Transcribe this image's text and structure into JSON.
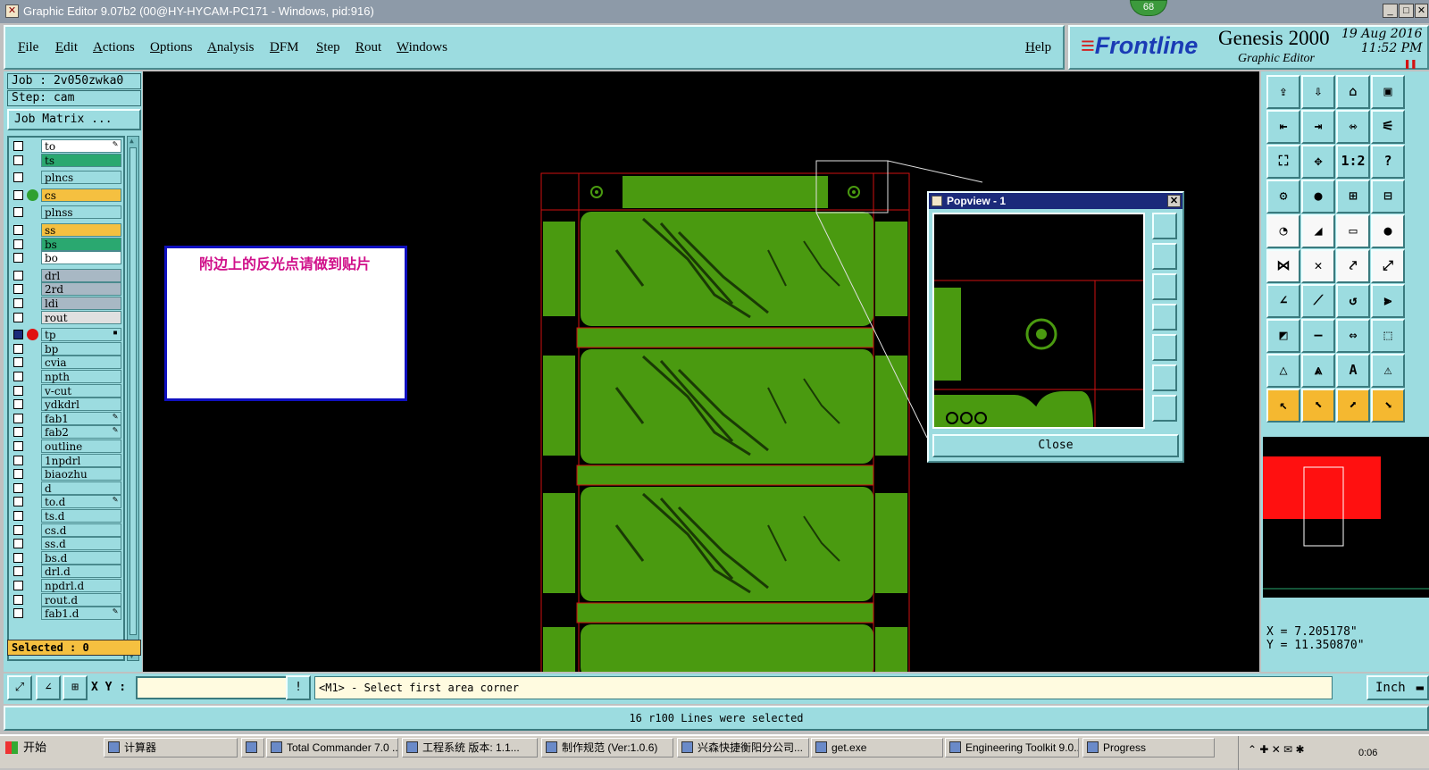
{
  "window": {
    "title": "Graphic Editor 9.07b2 (00@HY-HYCAM-PC171 - Windows, pid:916)",
    "badge": "68"
  },
  "menu": {
    "items": [
      "File",
      "Edit",
      "Actions",
      "Options",
      "Analysis",
      "DFM",
      "Step",
      "Rout",
      "Windows"
    ],
    "help": "Help"
  },
  "brand": {
    "logo": "Frontline",
    "product": "Genesis 2000",
    "subtitle": "Graphic Editor",
    "date": "19 Aug 2016",
    "time": "11:52 PM"
  },
  "job": {
    "job_label": "Job : 2v050zwka0",
    "step_label": "Step: cam",
    "matrix_button": "Job Matrix ...",
    "selected": "Selected : 0"
  },
  "layers": [
    {
      "name": "to",
      "color": "#ffffff",
      "mark": "✎"
    },
    {
      "name": "ts",
      "color": "#2aa870",
      "mark": ""
    },
    {
      "name": "plncs",
      "color": "#9cdce0",
      "mark": ""
    },
    {
      "name": "cs",
      "color": "#f5c040",
      "mark": "",
      "dot": "#30a030"
    },
    {
      "name": "plnss",
      "color": "#9cdce0",
      "mark": ""
    },
    {
      "name": "ss",
      "color": "#f5c040",
      "mark": ""
    },
    {
      "name": "bs",
      "color": "#2aa870",
      "mark": ""
    },
    {
      "name": "bo",
      "color": "#ffffff",
      "mark": ""
    },
    {
      "name": "drl",
      "color": "#a8b8c4",
      "mark": ""
    },
    {
      "name": "2rd",
      "color": "#a8b8c4",
      "mark": ""
    },
    {
      "name": "ldi",
      "color": "#a8b8c4",
      "mark": ""
    },
    {
      "name": "rout",
      "color": "#e0e0e0",
      "mark": ""
    },
    {
      "name": "tp",
      "color": "#9cdce0",
      "mark": "▪",
      "dot": "#e01010"
    },
    {
      "name": "bp",
      "color": "#9cdce0",
      "mark": ""
    },
    {
      "name": "cvia",
      "color": "#9cdce0",
      "mark": ""
    },
    {
      "name": "npth",
      "color": "#9cdce0",
      "mark": ""
    },
    {
      "name": "v-cut",
      "color": "#9cdce0",
      "mark": ""
    },
    {
      "name": "ydkdrl",
      "color": "#9cdce0",
      "mark": ""
    },
    {
      "name": "fab1",
      "color": "#9cdce0",
      "mark": "✎"
    },
    {
      "name": "fab2",
      "color": "#9cdce0",
      "mark": "✎"
    },
    {
      "name": "outline",
      "color": "#9cdce0",
      "mark": ""
    },
    {
      "name": "1npdrl",
      "color": "#9cdce0",
      "mark": ""
    },
    {
      "name": "biaozhu",
      "color": "#9cdce0",
      "mark": ""
    },
    {
      "name": "d",
      "color": "#9cdce0",
      "mark": ""
    },
    {
      "name": "to.d",
      "color": "#9cdce0",
      "mark": "✎"
    },
    {
      "name": "ts.d",
      "color": "#9cdce0",
      "mark": ""
    },
    {
      "name": "cs.d",
      "color": "#9cdce0",
      "mark": ""
    },
    {
      "name": "ss.d",
      "color": "#9cdce0",
      "mark": ""
    },
    {
      "name": "bs.d",
      "color": "#9cdce0",
      "mark": ""
    },
    {
      "name": "drl.d",
      "color": "#9cdce0",
      "mark": ""
    },
    {
      "name": "npdrl.d",
      "color": "#9cdce0",
      "mark": ""
    },
    {
      "name": "rout.d",
      "color": "#9cdce0",
      "mark": ""
    },
    {
      "name": "fab1.d",
      "color": "#9cdce0",
      "mark": "✎"
    }
  ],
  "note": {
    "text": "附边上的反光点请做到贴片"
  },
  "popview": {
    "title": "Popview - 1",
    "close_label": "Close"
  },
  "coords": {
    "x": "X = 7.205178\"",
    "y": "Y = 11.350870\""
  },
  "command": {
    "xy_label": "X Y :",
    "xy_value": "",
    "prompt": "<M1> - Select first area corner",
    "unit": "Inch"
  },
  "status": {
    "message": "16 r100 Lines were selected"
  },
  "taskbar": {
    "start": "开始",
    "tasks": [
      "计算器",
      "",
      "Total Commander 7.0 ...",
      "工程系统  版本: 1.1...",
      "制作规范 (Ver:1.0.6)",
      "兴森快捷衡阳分公司...",
      "get.exe",
      "Engineering Toolkit 9.0...",
      "Progress"
    ],
    "clock": "0:06"
  },
  "colors": {
    "pcb_green": "#4a9a10",
    "outline_red": "#d01010",
    "panel_bg": "#9cdce0"
  }
}
